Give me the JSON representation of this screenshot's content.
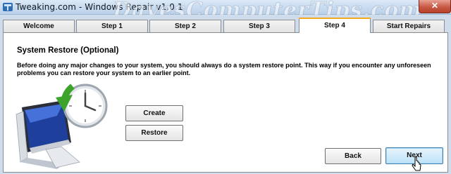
{
  "window": {
    "title": "Tweaking.com - Windows Repair v1.0.1",
    "watermark": "DavesComputerTips.com",
    "close_glyph": "✕"
  },
  "tabs": [
    {
      "label": "Welcome",
      "active": false
    },
    {
      "label": "Step 1",
      "active": false
    },
    {
      "label": "Step 2",
      "active": false
    },
    {
      "label": "Step 3",
      "active": false
    },
    {
      "label": "Step 4",
      "active": true
    },
    {
      "label": "Start Repairs",
      "active": false
    }
  ],
  "panel": {
    "title": "System Restore (Optional)",
    "description": "Before doing any major changes to your system, you should always do a system restore point. This way if you encounter any unforeseen problems you can restore your system to an earlier point.",
    "create_label": "Create",
    "restore_label": "Restore",
    "back_label": "Back",
    "next_label": "Next"
  },
  "icons": {
    "app": "tweaking-logo-icon",
    "restore": "system-restore-icon",
    "cursor": "mouse-pointer-icon"
  },
  "colors": {
    "active_tab_accent": "#f2a922",
    "close_button": "#c75a45",
    "next_button_border": "#3c7fb1"
  }
}
